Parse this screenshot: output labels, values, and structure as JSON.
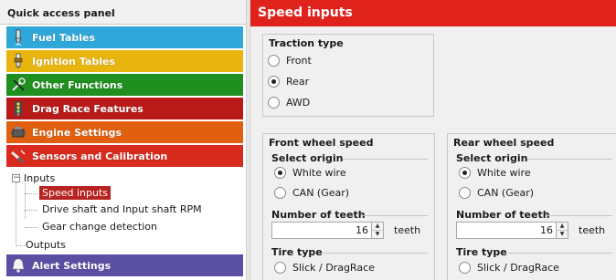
{
  "quick_access": {
    "title": "Quick access panel",
    "categories": [
      {
        "label": "Fuel Tables",
        "icon": "fuel-injector-icon",
        "color": "#2fa7d8"
      },
      {
        "label": "Ignition Tables",
        "icon": "spark-plug-icon",
        "color": "#e8b50f"
      },
      {
        "label": "Other Functions",
        "icon": "tools-icon",
        "color": "#1f8f1f"
      },
      {
        "label": "Drag Race Features",
        "icon": "drag-tree-icon",
        "color": "#b81a18"
      },
      {
        "label": "Engine Settings",
        "icon": "engine-icon",
        "color": "#e06010"
      },
      {
        "label": "Sensors and Calibration",
        "icon": "sensor-icon",
        "color": "#d92a1e"
      },
      {
        "label": "Alert Settings",
        "icon": "alert-bell-icon",
        "color": "#5a4fa3"
      }
    ],
    "tree": {
      "root": "Inputs",
      "expander": "−",
      "children": [
        "Speed inputs",
        "Drive shaft and Input shaft RPM",
        "Gear change detection"
      ],
      "selected": "Speed inputs",
      "sibling": "Outputs"
    }
  },
  "content": {
    "header": "Speed inputs",
    "header_color": "#e0221d",
    "traction": {
      "title": "Traction type",
      "options": [
        "Front",
        "Rear",
        "AWD"
      ],
      "selected": "Rear"
    },
    "front": {
      "title": "Front wheel speed",
      "origin_label": "Select origin",
      "origin_options": [
        "White wire",
        "CAN (Gear)"
      ],
      "origin_selected": "White wire",
      "teeth_label": "Number of teeth",
      "teeth_value": "16",
      "teeth_unit": "teeth",
      "tire_label": "Tire type",
      "tire_option": "Slick / DragRace"
    },
    "rear": {
      "title": "Rear wheel speed",
      "origin_label": "Select origin",
      "origin_options": [
        "White wire",
        "CAN (Gear)"
      ],
      "origin_selected": "White wire",
      "teeth_label": "Number of teeth",
      "teeth_value": "16",
      "teeth_unit": "teeth",
      "tire_label": "Tire type",
      "tire_option": "Slick / DragRace"
    }
  }
}
